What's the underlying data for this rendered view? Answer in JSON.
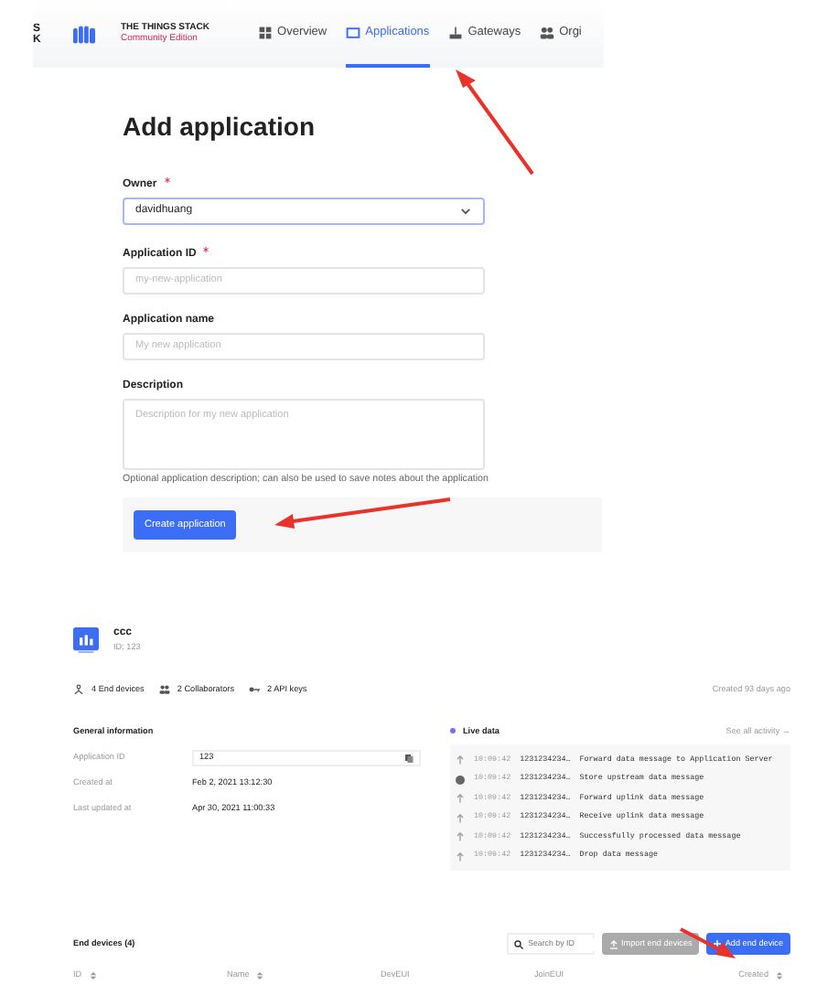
{
  "nav": {
    "cut_letters": [
      "S",
      "K"
    ],
    "brand": {
      "title": "THE THINGS STACK",
      "subtitle": "Community Edition"
    },
    "tabs": [
      {
        "label": "Overview",
        "selected": false
      },
      {
        "label": "Applications",
        "selected": true
      },
      {
        "label": "Gateways",
        "selected": false
      },
      {
        "label": "Orgi",
        "selected": false
      }
    ]
  },
  "form": {
    "title": "Add application",
    "fields": [
      {
        "label": "Owner",
        "required": true,
        "kind": "select",
        "value": "davidhuang"
      },
      {
        "label": "Application ID",
        "required": true,
        "kind": "input",
        "placeholder": "my-new-application"
      },
      {
        "label": "Application name",
        "required": false,
        "kind": "input",
        "placeholder": "My new application"
      },
      {
        "label": "Description",
        "required": false,
        "kind": "textarea",
        "placeholder": "Description for my new application",
        "help": "Optional application description; can also be used to save notes about the application"
      }
    ],
    "submit": "Create application"
  },
  "app": {
    "name": "ccc",
    "id_line": "ID: 123",
    "stats": [
      "4 End devices",
      "2 Collaborators",
      "2 API keys"
    ],
    "created": "Created 93 days ago",
    "general": {
      "title": "General information",
      "rows": [
        {
          "label": "Application ID",
          "value": "123",
          "kind": "copyable"
        },
        {
          "label": "Created at",
          "value": "Feb 2, 2021 13:12:30",
          "kind": "plain"
        },
        {
          "label": "Last updated at",
          "value": "Apr 30, 2021 11:00:33",
          "kind": "plain"
        }
      ]
    },
    "live": {
      "title": "Live data",
      "link": "See all activity →",
      "events": [
        {
          "kind": "up",
          "time": "10:09:42",
          "device": "1231234234…",
          "message": "Forward data message to Application Server"
        },
        {
          "kind": "dot",
          "time": "10:09:42",
          "device": "1231234234…",
          "message": "Store upstream data message"
        },
        {
          "kind": "up",
          "time": "10:09:42",
          "device": "1231234234…",
          "message": "Forward uplink data message"
        },
        {
          "kind": "up",
          "time": "10:09:42",
          "device": "1231234234…",
          "message": "Receive uplink data message"
        },
        {
          "kind": "up",
          "time": "10:09:42",
          "device": "1231234234…",
          "message": "Successfully processed data message"
        },
        {
          "kind": "up",
          "time": "10:09:42",
          "device": "1231234234…",
          "message": "Drop data message"
        }
      ]
    },
    "devices": {
      "title": "End devices (4)",
      "search_placeholder": "Search by ID",
      "import": "Import end devices",
      "add": "Add end device",
      "columns": [
        {
          "label": "ID",
          "sortable": true
        },
        {
          "label": "Name",
          "sortable": true
        },
        {
          "label": "DevEUI",
          "sortable": false
        },
        {
          "label": "JoinEUI",
          "sortable": false
        },
        {
          "label": "Created",
          "sortable": true
        }
      ]
    }
  }
}
